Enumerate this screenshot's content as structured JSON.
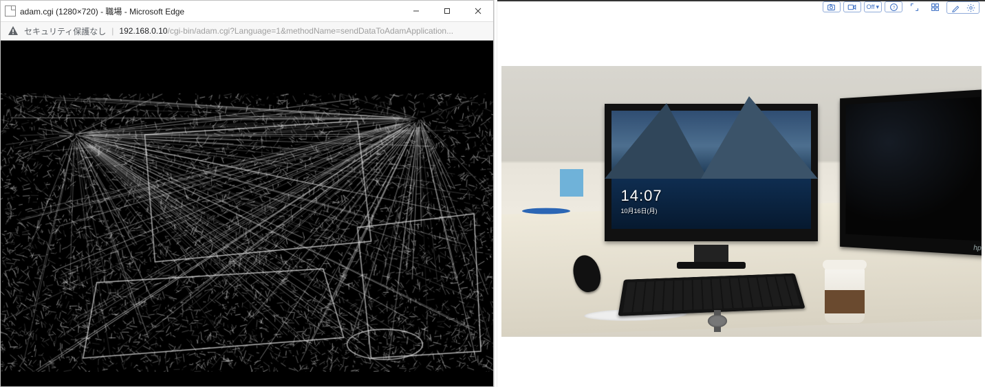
{
  "edge_window": {
    "title": "adam.cgi (1280×720) - 職場 - Microsoft Edge",
    "security_label": "セキュリティ保護なし",
    "separator": "|",
    "url_host": "192.168.0.10",
    "url_rest": "/cgi-bin/adam.cgi?Language=1&methodName=sendDataToAdamApplication..."
  },
  "right_toolbar": {
    "off_label": "Off"
  },
  "lockscreen": {
    "time": "14:07",
    "date": "10月16日(月)"
  },
  "monitor2": {
    "brand": "hp"
  }
}
